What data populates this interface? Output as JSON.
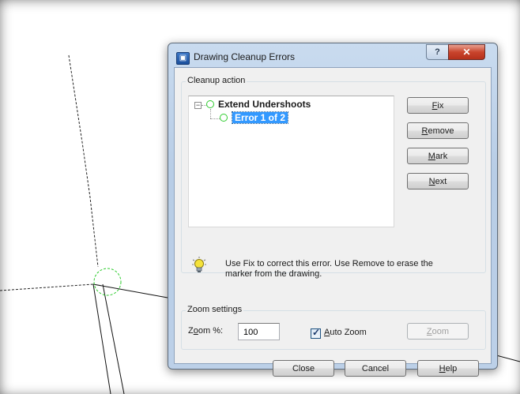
{
  "dialog": {
    "title": "Drawing Cleanup Errors",
    "help_button": "?",
    "close_button": "✕"
  },
  "cleanup_action": {
    "group_label": "Cleanup action",
    "tree": {
      "expander": "−",
      "root_label": "Extend Undershoots",
      "child_label": "Error 1 of 2"
    },
    "buttons": {
      "fix": {
        "pre": "",
        "accel": "F",
        "post": "ix"
      },
      "remove": {
        "pre": "",
        "accel": "R",
        "post": "emove"
      },
      "mark": {
        "pre": "",
        "accel": "M",
        "post": "ark"
      },
      "next": {
        "pre": "",
        "accel": "N",
        "post": "ext"
      }
    },
    "info_text": "Use Fix to correct this error. Use Remove to erase the  marker from the drawing."
  },
  "zoom_settings": {
    "group_label": "Zoom settings",
    "zoom_label": {
      "pre": "Z",
      "accel": "o",
      "post": "om %:"
    },
    "zoom_value": "100",
    "auto_zoom": {
      "checked": true,
      "pre": "",
      "accel": "A",
      "post": "uto Zoom"
    },
    "zoom_button": {
      "pre": "",
      "accel": "Z",
      "post": "oom"
    }
  },
  "footer": {
    "close": "Close",
    "cancel": "Cancel",
    "help": {
      "pre": "",
      "accel": "H",
      "post": "elp"
    }
  },
  "colors": {
    "selection": "#3399ff",
    "node_circle": "#2ecc2e",
    "close_button": "#c9442c"
  }
}
